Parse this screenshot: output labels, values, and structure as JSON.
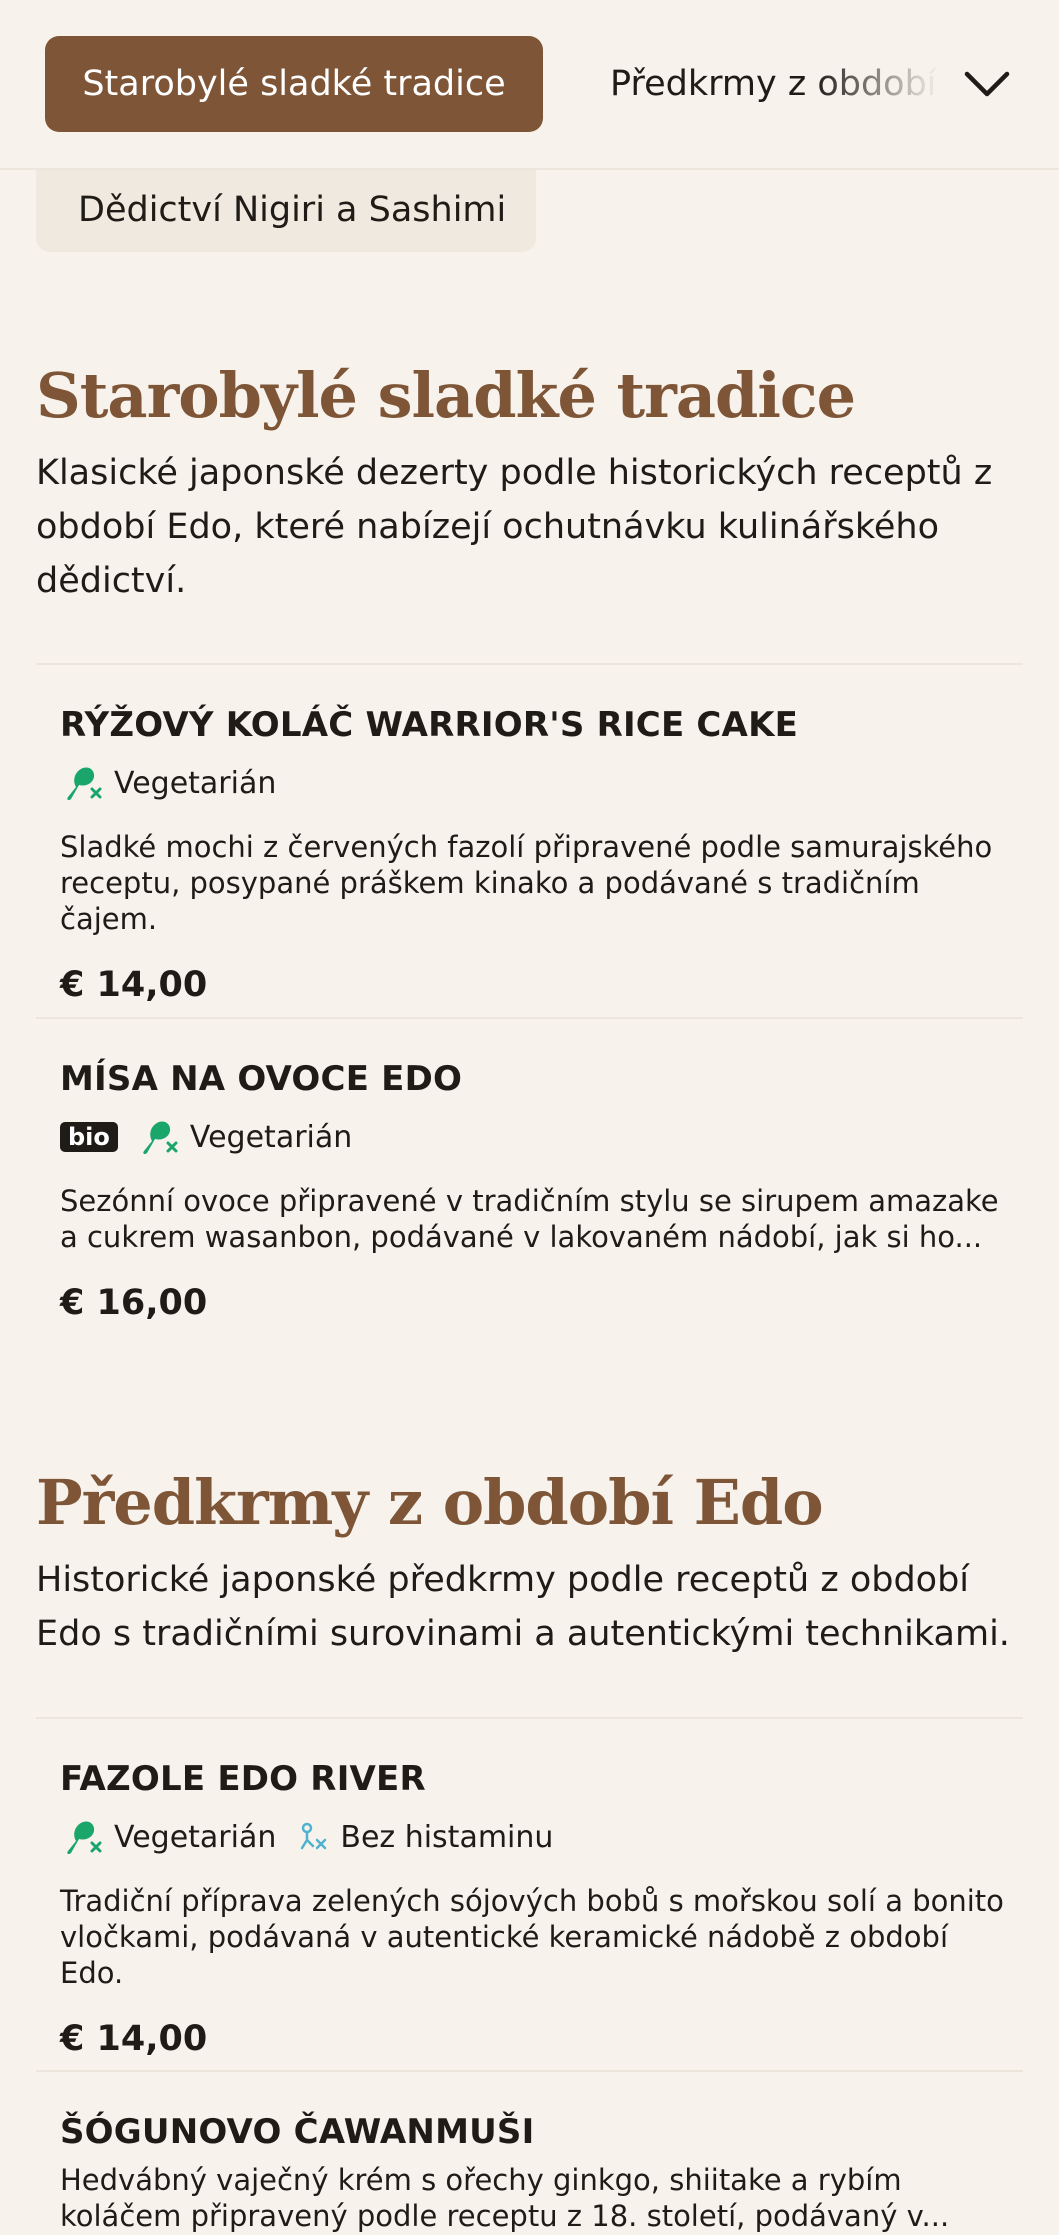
{
  "categories": {
    "active_label": "Starobylé sladké tradice",
    "next_label": "Předkrmy z období Edo",
    "second_row_label": "Dědictví Nigiri a Sashimi",
    "toggle_icon": "chevron-down-icon"
  },
  "sections": [
    {
      "title": "Starobylé sladké tradice",
      "description": "Klasické japonské dezerty podle historických receptů z období Edo, které nabízejí ochutnávku kulinářského dědictví.",
      "items": [
        {
          "name": "RÝŽOVÝ KOLÁČ WARRIOR'S RICE CAKE",
          "tags": [
            "Vegetarián"
          ],
          "description": "Sladké mochi z červených fazolí připravené podle samurajského receptu, posypané práškem kinako a podávané s tradičním čajem.",
          "price": "€ 14,00"
        },
        {
          "name": "MÍSA NA OVOCE EDO",
          "badge": "bio",
          "tags": [
            "Vegetarián"
          ],
          "description": "Sezónní ovoce připravené v tradičním stylu se sirupem amazake a cukrem wasanbon, podávané v lakovaném nádobí, jak si ho...",
          "price": "€ 16,00"
        }
      ]
    },
    {
      "title": "Předkrmy z období Edo",
      "description": "Historické japonské předkrmy podle receptů z období Edo s tradičními surovinami a autentickými technikami.",
      "items": [
        {
          "name": "FAZOLE EDO RIVER",
          "tags": [
            "Vegetarián",
            "Bez histaminu"
          ],
          "description": "Tradiční příprava zelených sójových bobů s mořskou solí a bonito vločkami, podávaná v autentické keramické nádobě z období Edo.",
          "price": "€ 14,00"
        },
        {
          "name": "ŠÓGUNOVO ČAWANMUŠI",
          "description": "Hedvábný vaječný krém s ořechy ginkgo, shiitake a rybím koláčem připravený podle receptu z 18. století, podávaný v..."
        }
      ]
    }
  ],
  "colors": {
    "accent": "#7e5537",
    "background": "#f7f3ec",
    "vegetarian_icon": "#1aa56a",
    "histamine_icon": "#4fb3cf"
  },
  "icons": {
    "vegetarian": "meat-crossed-icon",
    "histamine_free": "histamine-free-icon"
  }
}
